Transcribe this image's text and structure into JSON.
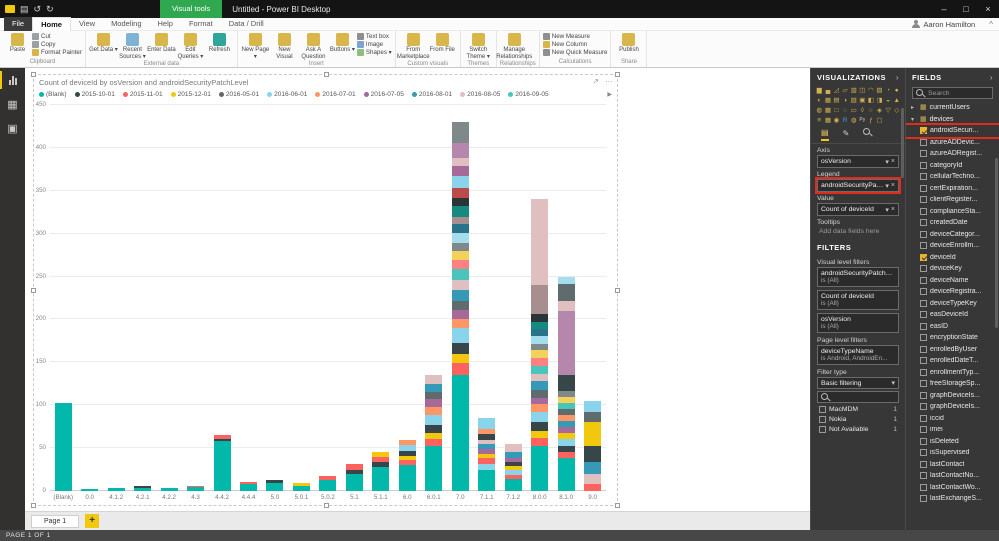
{
  "titlebar": {
    "context_label": "Visual tools",
    "title": "Untitled - Power BI Desktop",
    "user": "Aaron Hamilton"
  },
  "ribbon": {
    "tabs": [
      {
        "label": "File",
        "file": true
      },
      {
        "label": "Home",
        "active": true
      },
      {
        "label": "View"
      },
      {
        "label": "Modeling"
      },
      {
        "label": "Help"
      },
      {
        "label": "Format"
      },
      {
        "label": "Data / Drill"
      }
    ],
    "groups": [
      {
        "label": "Clipboard",
        "big": [
          {
            "label": "Paste",
            "icon": "paste"
          }
        ],
        "small": [
          {
            "label": "Cut",
            "icon": "cut"
          },
          {
            "label": "Copy",
            "icon": "copy"
          },
          {
            "label": "Format Painter",
            "icon": "brush"
          }
        ]
      },
      {
        "label": "External data",
        "big": [
          {
            "label": "Get Data",
            "icon": "db",
            "dd": true
          },
          {
            "label": "Recent Sources",
            "icon": "clock",
            "dd": true
          },
          {
            "label": "Enter Data",
            "icon": "table"
          },
          {
            "label": "Edit Queries",
            "icon": "edit",
            "dd": true
          },
          {
            "label": "Refresh",
            "icon": "refresh"
          }
        ]
      },
      {
        "label": "Insert",
        "big": [
          {
            "label": "New Page",
            "icon": "page",
            "dd": true
          },
          {
            "label": "New Visual",
            "icon": "chart"
          },
          {
            "label": "Ask A Question",
            "icon": "qa"
          },
          {
            "label": "Buttons",
            "icon": "button",
            "dd": true
          }
        ],
        "small": [
          {
            "label": "Text box",
            "icon": "text"
          },
          {
            "label": "Image",
            "icon": "image"
          },
          {
            "label": "Shapes",
            "icon": "shapes",
            "dd": true
          }
        ]
      },
      {
        "label": "Custom visuals",
        "big": [
          {
            "label": "From Marketplace",
            "icon": "store"
          },
          {
            "label": "From File",
            "icon": "file"
          }
        ]
      },
      {
        "label": "Themes",
        "big": [
          {
            "label": "Switch Theme",
            "icon": "theme",
            "dd": true
          }
        ]
      },
      {
        "label": "Relationships",
        "big": [
          {
            "label": "Manage Relationships",
            "icon": "rel"
          }
        ]
      },
      {
        "label": "Calculations",
        "small": [
          {
            "label": "New Measure",
            "icon": "calc"
          },
          {
            "label": "New Column",
            "icon": "col"
          },
          {
            "label": "New Quick Measure",
            "icon": "quick"
          }
        ]
      },
      {
        "label": "Share",
        "big": [
          {
            "label": "Publish",
            "icon": "publish"
          }
        ]
      }
    ]
  },
  "visualizations": {
    "header": "VISUALIZATIONS",
    "icon_rows": [
      [
        "▆",
        "▄",
        "◿",
        "▱",
        "▥",
        "◫",
        "◠",
        "▧",
        "◔",
        "●"
      ],
      [
        "◐",
        "▦",
        "▤",
        "◑",
        "▨",
        "▣",
        "◧",
        "◨",
        "◒",
        "▲"
      ],
      [
        "◍",
        "▩",
        "□",
        "◌",
        "▭",
        "◊",
        "○",
        "◈",
        "▽",
        "◇"
      ],
      [
        "≡",
        "▦",
        "◉",
        "R",
        "◍",
        "Py",
        "ƒ",
        "▢"
      ]
    ],
    "wells": {
      "axis_label": "Axis",
      "axis_value": "osVersion",
      "legend_label": "Legend",
      "legend_value": "androidSecurityPatchLe",
      "value_label": "Value",
      "value_value": "Count of deviceId",
      "tooltips_label": "Tooltips",
      "tooltips_placeholder": "Add data fields here"
    }
  },
  "filters": {
    "header": "FILTERS",
    "visual_level_label": "Visual level filters",
    "visual_filters": [
      {
        "name": "androidSecurityPatchL...",
        "condition": "is (All)"
      },
      {
        "name": "Count of deviceId",
        "condition": "is (All)"
      },
      {
        "name": "osVersion",
        "condition": "is (All)"
      }
    ],
    "page_level_label": "Page level filters",
    "page_filters": [
      {
        "name": "deviceTypeName",
        "condition": "is Android, AndroidEn..."
      }
    ],
    "filter_type_label": "Filter type",
    "filter_type_value": "Basic filtering",
    "options": [
      {
        "label": "MacMDM",
        "count": "1"
      },
      {
        "label": "Nokia",
        "count": "1"
      },
      {
        "label": "Not Available",
        "count": "1"
      }
    ]
  },
  "fields": {
    "header": "FIELDS",
    "search_placeholder": "Search",
    "tables": [
      {
        "name": "currentUsers",
        "expanded": false
      },
      {
        "name": "devices",
        "expanded": true
      }
    ],
    "columns": [
      {
        "name": "androidSecuri...",
        "checked": true,
        "annotated": true
      },
      {
        "name": "azureADDevic..."
      },
      {
        "name": "azureADRegist..."
      },
      {
        "name": "categoryId"
      },
      {
        "name": "cellularTechno..."
      },
      {
        "name": "certExpiration..."
      },
      {
        "name": "clientRegister..."
      },
      {
        "name": "complianceSta..."
      },
      {
        "name": "createdDate"
      },
      {
        "name": "deviceCategor..."
      },
      {
        "name": "deviceEnrollm..."
      },
      {
        "name": "deviceId",
        "checked": true
      },
      {
        "name": "deviceKey"
      },
      {
        "name": "deviceName"
      },
      {
        "name": "deviceRegistra..."
      },
      {
        "name": "deviceTypeKey"
      },
      {
        "name": "easDeviceId"
      },
      {
        "name": "easID"
      },
      {
        "name": "encryptionState"
      },
      {
        "name": "enrolledByUser"
      },
      {
        "name": "enrolledDateT..."
      },
      {
        "name": "enrollmentTyp..."
      },
      {
        "name": "freeStorageSp..."
      },
      {
        "name": "graphDeviceIs..."
      },
      {
        "name": "graphDeviceIs..."
      },
      {
        "name": "iccid"
      },
      {
        "name": "imei"
      },
      {
        "name": "isDeleted"
      },
      {
        "name": "isSupervised"
      },
      {
        "name": "lastContact"
      },
      {
        "name": "lastContactNo..."
      },
      {
        "name": "lastContactWo..."
      },
      {
        "name": "lastExchangeS..."
      }
    ]
  },
  "pages": {
    "current": "Page 1"
  },
  "statusbar": {
    "text": "PAGE 1 OF 1"
  },
  "chart_data": {
    "type": "bar",
    "stacked": true,
    "title": "Count of deviceId by osVersion and androidSecurityPatchLevel",
    "xlabel": "osVersion",
    "ylabel": "Count of deviceId",
    "ylim": [
      0,
      450
    ],
    "ytick_step": 50,
    "grid": true,
    "legend_position": "top",
    "legend_field": "androidSecurityPatchLevel",
    "palette": [
      "#01B8AA",
      "#374649",
      "#FD625E",
      "#F2C80F",
      "#5F6B6D",
      "#8AD4EB",
      "#FE9666",
      "#A66999",
      "#3599B8",
      "#DFBFBF",
      "#4AC5BB",
      "#FB8281",
      "#F4D25A",
      "#7F898A",
      "#A4DDEE",
      "#B687AC",
      "#28738A",
      "#A78F8F",
      "#168980",
      "#293537",
      "#BB4A4A"
    ],
    "legend": [
      {
        "label": "(Blank)",
        "color": 0
      },
      {
        "label": "2015-10-01",
        "color": 1
      },
      {
        "label": "2015-11-01",
        "color": 2
      },
      {
        "label": "2015-12-01",
        "color": 3
      },
      {
        "label": "2016-05-01",
        "color": 4
      },
      {
        "label": "2016-06-01",
        "color": 5
      },
      {
        "label": "2016-07-01",
        "color": 6
      },
      {
        "label": "2016-07-05",
        "color": 7
      },
      {
        "label": "2016-08-01",
        "color": 8
      },
      {
        "label": "2016-08-05",
        "color": 9
      },
      {
        "label": "2016-09-05",
        "color": 10
      }
    ],
    "categories": [
      "(Blank)",
      "0.0",
      "4.1.2",
      "4.2.1",
      "4.2.2",
      "4.3",
      "4.4.2",
      "4.4.4",
      "5.0",
      "5.0.1",
      "5.0.2",
      "5.1",
      "5.1.1",
      "6.0",
      "6.0.1",
      "7.0",
      "7.1.1",
      "7.1.2",
      "8.0.0",
      "8.1.0",
      "9.0"
    ],
    "totals": [
      103,
      2,
      3,
      6,
      3,
      6,
      65,
      11,
      13,
      9,
      18,
      31,
      46,
      60,
      135,
      430,
      85,
      55,
      340,
      250,
      105
    ],
    "bars": [
      [
        [
          0,
          103
        ]
      ],
      [
        [
          0,
          2
        ]
      ],
      [
        [
          0,
          3
        ]
      ],
      [
        [
          0,
          4
        ],
        [
          1,
          2
        ]
      ],
      [
        [
          0,
          3
        ]
      ],
      [
        [
          0,
          5
        ],
        [
          2,
          1
        ]
      ],
      [
        [
          0,
          58
        ],
        [
          1,
          3
        ],
        [
          2,
          4
        ]
      ],
      [
        [
          0,
          8
        ],
        [
          2,
          3
        ]
      ],
      [
        [
          0,
          9
        ],
        [
          1,
          4
        ]
      ],
      [
        [
          0,
          6
        ],
        [
          3,
          3
        ]
      ],
      [
        [
          0,
          13
        ],
        [
          2,
          5
        ]
      ],
      [
        [
          0,
          20
        ],
        [
          1,
          5
        ],
        [
          2,
          6
        ]
      ],
      [
        [
          0,
          28
        ],
        [
          1,
          6
        ],
        [
          2,
          6
        ],
        [
          3,
          6
        ]
      ],
      [
        [
          0,
          30
        ],
        [
          2,
          6
        ],
        [
          3,
          5
        ],
        [
          1,
          6
        ],
        [
          5,
          7
        ],
        [
          6,
          6
        ]
      ],
      [
        [
          0,
          52
        ],
        [
          2,
          9
        ],
        [
          3,
          7
        ],
        [
          1,
          9
        ],
        [
          5,
          12
        ],
        [
          6,
          9
        ],
        [
          7,
          9
        ],
        [
          4,
          9
        ],
        [
          8,
          9
        ],
        [
          9,
          10
        ]
      ],
      [
        [
          0,
          135
        ],
        [
          2,
          14
        ],
        [
          3,
          11
        ],
        [
          1,
          13
        ],
        [
          5,
          17
        ],
        [
          6,
          11
        ],
        [
          7,
          10
        ],
        [
          4,
          11
        ],
        [
          8,
          13
        ],
        [
          9,
          11
        ],
        [
          10,
          13
        ],
        [
          11,
          11
        ],
        [
          12,
          10
        ],
        [
          13,
          9
        ],
        [
          14,
          12
        ],
        [
          16,
          10
        ],
        [
          17,
          9
        ],
        [
          18,
          12
        ],
        [
          19,
          10
        ],
        [
          20,
          12
        ],
        [
          5,
          13
        ],
        [
          7,
          12
        ],
        [
          9,
          9
        ],
        [
          15,
          18
        ],
        [
          13,
          24
        ]
      ],
      [
        [
          0,
          24
        ],
        [
          5,
          8
        ],
        [
          2,
          6
        ],
        [
          3,
          5
        ],
        [
          7,
          6
        ],
        [
          8,
          6
        ],
        [
          9,
          5
        ],
        [
          1,
          6
        ],
        [
          6,
          6
        ],
        [
          5,
          13
        ]
      ],
      [
        [
          0,
          14
        ],
        [
          2,
          5
        ],
        [
          5,
          6
        ],
        [
          3,
          4
        ],
        [
          1,
          5
        ],
        [
          7,
          5
        ],
        [
          8,
          6
        ],
        [
          9,
          10
        ]
      ],
      [
        [
          0,
          52
        ],
        [
          2,
          10
        ],
        [
          3,
          8
        ],
        [
          1,
          10
        ],
        [
          5,
          12
        ],
        [
          6,
          9
        ],
        [
          7,
          8
        ],
        [
          4,
          9
        ],
        [
          8,
          10
        ],
        [
          9,
          9
        ],
        [
          10,
          9
        ],
        [
          11,
          9
        ],
        [
          12,
          9
        ],
        [
          13,
          8
        ],
        [
          14,
          9
        ],
        [
          16,
          8
        ],
        [
          18,
          8
        ],
        [
          19,
          9
        ],
        [
          17,
          34
        ],
        [
          9,
          100
        ]
      ],
      [
        [
          0,
          38
        ],
        [
          2,
          7
        ],
        [
          1,
          7
        ],
        [
          5,
          9
        ],
        [
          3,
          7
        ],
        [
          7,
          7
        ],
        [
          8,
          7
        ],
        [
          6,
          7
        ],
        [
          4,
          7
        ],
        [
          10,
          7
        ],
        [
          12,
          7
        ],
        [
          13,
          7
        ],
        [
          1,
          18
        ],
        [
          15,
          75
        ],
        [
          9,
          12
        ],
        [
          4,
          20
        ],
        [
          14,
          8
        ]
      ],
      [
        [
          2,
          8
        ],
        [
          9,
          12
        ],
        [
          8,
          14
        ],
        [
          1,
          18
        ],
        [
          3,
          28
        ],
        [
          4,
          12
        ],
        [
          5,
          13
        ]
      ]
    ]
  }
}
